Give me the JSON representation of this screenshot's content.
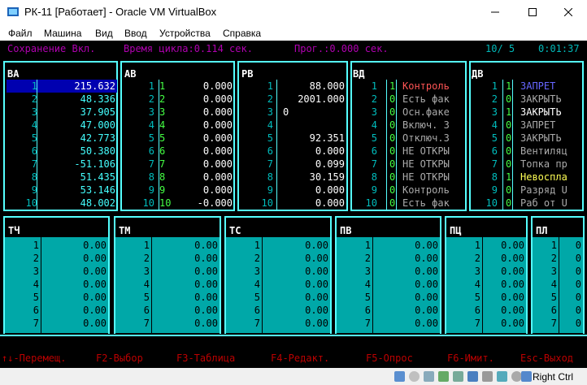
{
  "window": {
    "title": "РК-11 [Работает] - Oracle VM VirtualBox",
    "min_icon": "minimize-icon",
    "max_icon": "maximize-icon",
    "close_icon": "close-icon"
  },
  "menu": [
    "Файл",
    "Машина",
    "Вид",
    "Ввод",
    "Устройства",
    "Справка"
  ],
  "status": {
    "save": "Сохранение Вкл.",
    "cycle": "Время цикла:0.114 сек.",
    "prog": "Прог.:0.000 сек.",
    "page": "10/ 5",
    "clock": "0:01:37"
  },
  "panels": {
    "ba": {
      "title": "ВА",
      "rows": [
        {
          "n": "1",
          "v": "215.632"
        },
        {
          "n": "2",
          "v": "48.336"
        },
        {
          "n": "3",
          "v": "37.905"
        },
        {
          "n": "4",
          "v": "47.000"
        },
        {
          "n": "5",
          "v": "42.773"
        },
        {
          "n": "6",
          "v": "50.380"
        },
        {
          "n": "7",
          "v": "-51.106"
        },
        {
          "n": "8",
          "v": "51.435"
        },
        {
          "n": "9",
          "v": "53.146"
        },
        {
          "n": "10",
          "v": "48.002"
        }
      ]
    },
    "av": {
      "title": "АВ",
      "rows": [
        {
          "n": "1",
          "i": "1",
          "v": "0.000"
        },
        {
          "n": "2",
          "i": "2",
          "v": "0.000"
        },
        {
          "n": "3",
          "i": "3",
          "v": "0.000"
        },
        {
          "n": "4",
          "i": "4",
          "v": "0.000"
        },
        {
          "n": "5",
          "i": "5",
          "v": "0.000"
        },
        {
          "n": "6",
          "i": "6",
          "v": "0.000"
        },
        {
          "n": "7",
          "i": "7",
          "v": "0.000"
        },
        {
          "n": "8",
          "i": "8",
          "v": "0.000"
        },
        {
          "n": "9",
          "i": "9",
          "v": "0.000"
        },
        {
          "n": "10",
          "i": "10",
          "v": "-0.000"
        }
      ]
    },
    "rv": {
      "title": "РВ",
      "rows": [
        {
          "n": "1",
          "i": "1",
          "v": "88.000"
        },
        {
          "n": "2",
          "i": "2",
          "v": "2001.000"
        },
        {
          "n": "3",
          "i": "3",
          "v": "0"
        },
        {
          "n": "4",
          "i": "4",
          "v": ""
        },
        {
          "n": "5",
          "i": "5",
          "v": "92.351"
        },
        {
          "n": "6",
          "i": "6",
          "v": "0.000"
        },
        {
          "n": "7",
          "i": "7",
          "v": "0.099"
        },
        {
          "n": "8",
          "i": "8",
          "v": "30.159"
        },
        {
          "n": "9",
          "i": "9",
          "v": "0.000"
        },
        {
          "n": "10",
          "i": "10",
          "v": "0.000"
        }
      ]
    },
    "vd": {
      "title": "ВД",
      "rows": [
        {
          "n": "1",
          "b": "1",
          "t": "Контроль",
          "c": "red"
        },
        {
          "n": "2",
          "b": "0",
          "t": "Есть фак",
          "c": "gray"
        },
        {
          "n": "3",
          "b": "0",
          "t": "Осн.факе",
          "c": "gray"
        },
        {
          "n": "4",
          "b": "0",
          "t": "Включ. 3",
          "c": "gray"
        },
        {
          "n": "5",
          "b": "0",
          "t": "Отключ.3",
          "c": "gray"
        },
        {
          "n": "6",
          "b": "0",
          "t": "НЕ ОТКРЫ",
          "c": "gray"
        },
        {
          "n": "7",
          "b": "0",
          "t": "НЕ ОТКРЫ",
          "c": "gray"
        },
        {
          "n": "8",
          "b": "0",
          "t": "НЕ ОТКРЫ",
          "c": "gray"
        },
        {
          "n": "9",
          "b": "0",
          "t": "Контроль",
          "c": "gray"
        },
        {
          "n": "10",
          "b": "0",
          "t": "Есть фак",
          "c": "gray"
        }
      ]
    },
    "dv": {
      "title": "ДВ",
      "rows": [
        {
          "n": "1",
          "b": "1",
          "t": "ЗАПРЕТ",
          "c": "blue"
        },
        {
          "n": "2",
          "b": "0",
          "t": "ЗАКРЫТЬ",
          "c": "gray"
        },
        {
          "n": "3",
          "b": "1",
          "t": "ЗАКРЫТЬ",
          "c": "white"
        },
        {
          "n": "4",
          "b": "0",
          "t": "ЗАПРЕТ",
          "c": "gray"
        },
        {
          "n": "5",
          "b": "0",
          "t": "ЗАКРЫТЬ",
          "c": "gray"
        },
        {
          "n": "6",
          "b": "0",
          "t": "Вентиляц",
          "c": "gray"
        },
        {
          "n": "7",
          "b": "0",
          "t": "Топка пр",
          "c": "gray"
        },
        {
          "n": "8",
          "b": "1",
          "t": "Невоспла",
          "c": "yellow"
        },
        {
          "n": "9",
          "b": "0",
          "t": "Разряд U",
          "c": "gray"
        },
        {
          "n": "10",
          "b": "0",
          "t": "Раб от U",
          "c": "gray"
        }
      ]
    },
    "bottom": [
      {
        "title": "ТЧ",
        "val": "0.00"
      },
      {
        "title": "ТМ",
        "val": "0.00"
      },
      {
        "title": "ТС",
        "val": "0.00"
      },
      {
        "title": "ПВ",
        "val": "0.00"
      },
      {
        "title": "ПЦ",
        "val": "0.00"
      },
      {
        "title": "ПЛ",
        "val": "0"
      }
    ],
    "bottom_rows": [
      "1",
      "2",
      "3",
      "4",
      "5",
      "6",
      "7"
    ]
  },
  "fkeys": [
    "↑↓-Перемещ.",
    "F2-Выбор",
    "F3-Таблица",
    "F4-Редакт.",
    "F5-Опрос",
    "F6-Имит.",
    "Esc-Выход"
  ],
  "tray": {
    "host_key": "Right Ctrl"
  },
  "colors": {
    "accent_cyan": "#55ffff",
    "teal": "#00a8a8",
    "magenta": "#b000b0",
    "selection": "#0000b0"
  }
}
